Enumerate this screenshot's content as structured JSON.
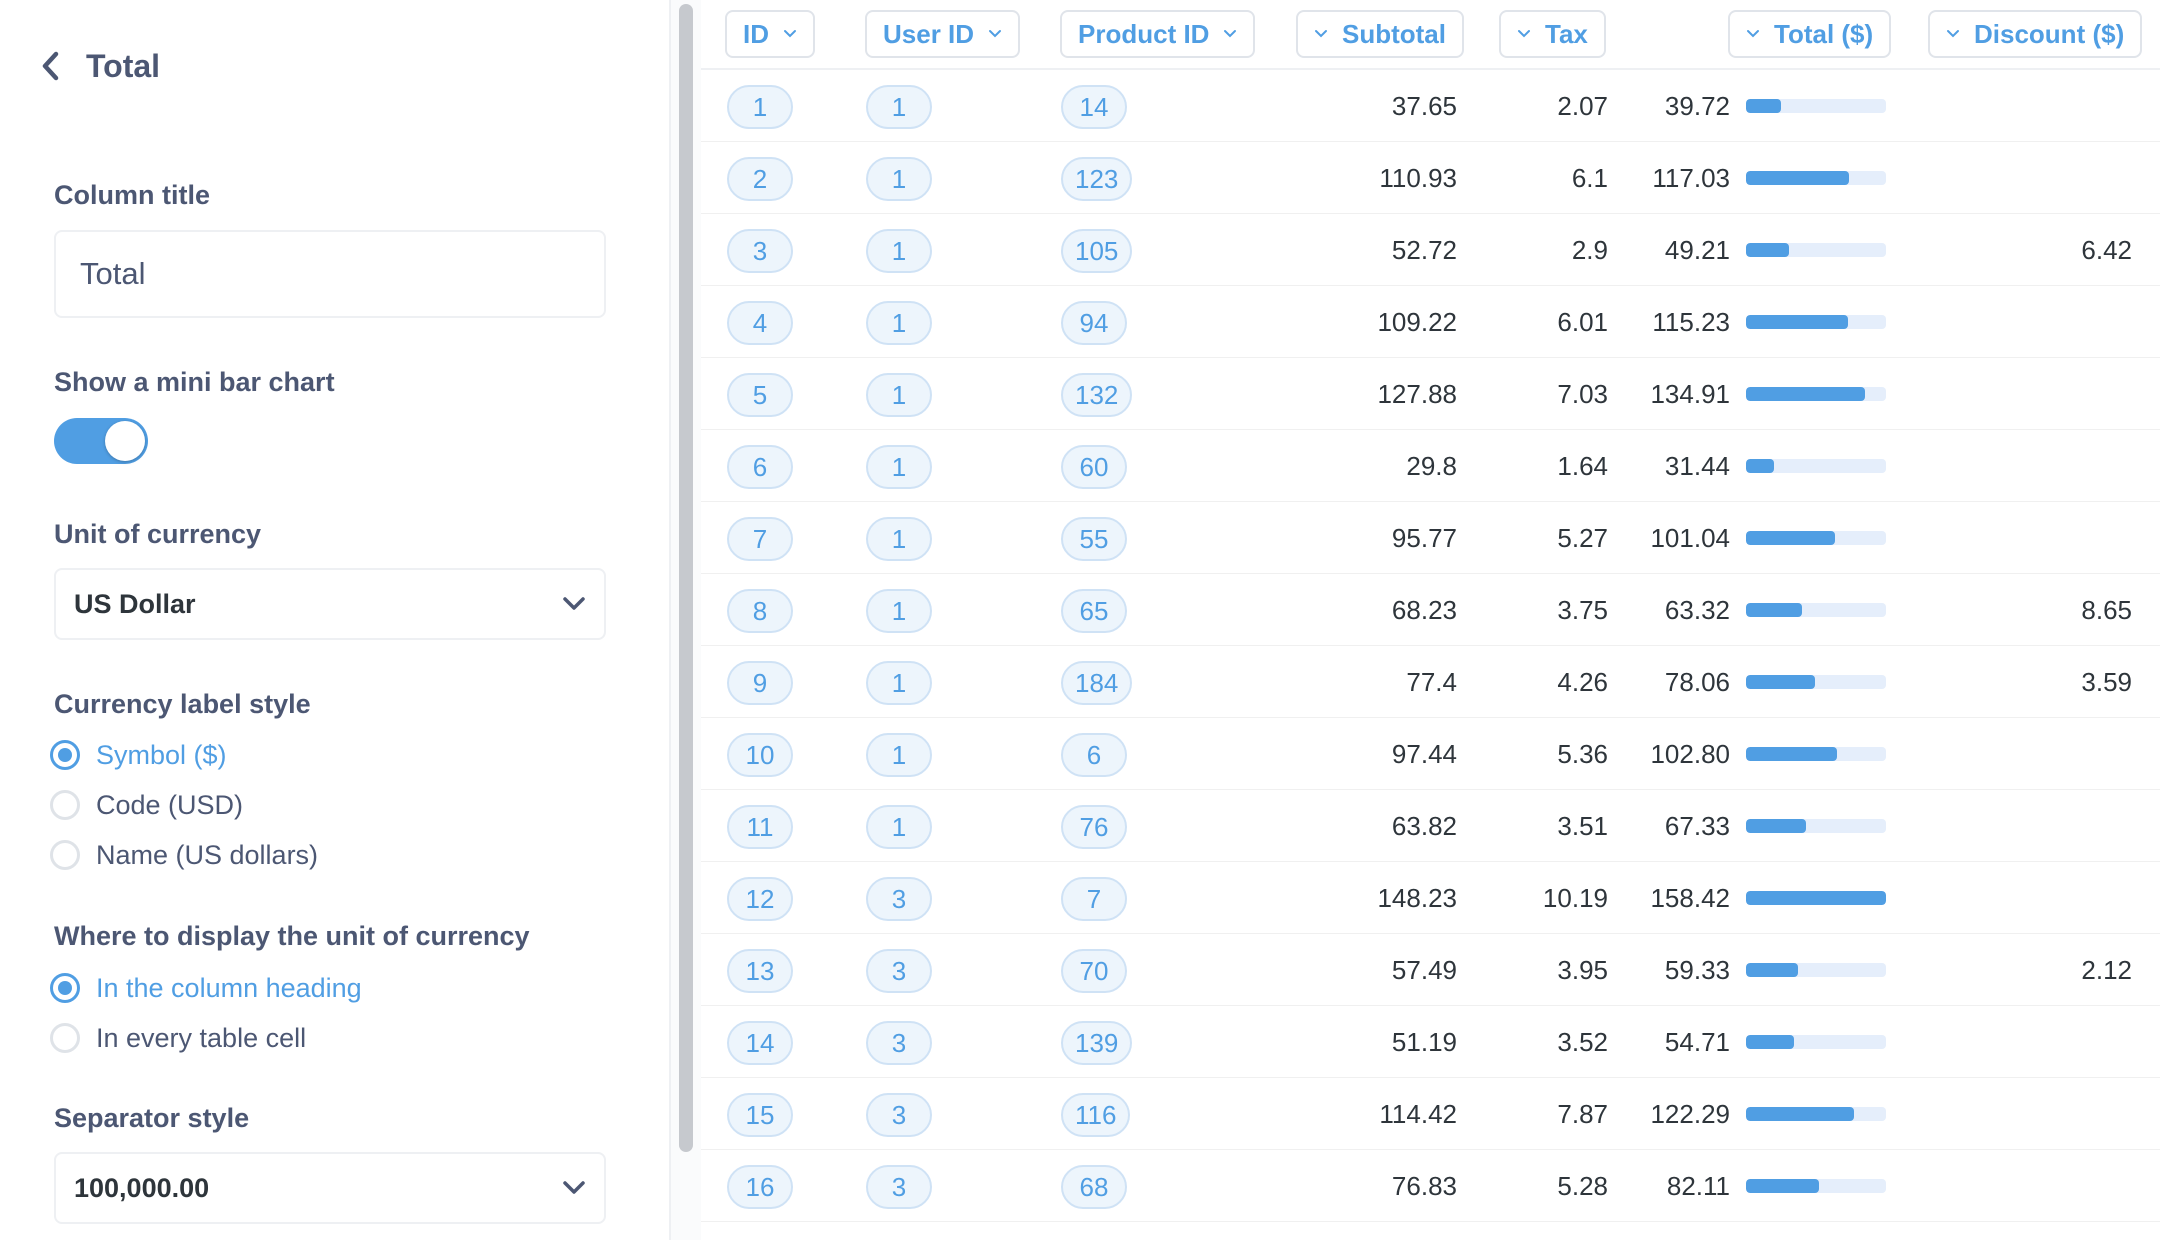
{
  "panel": {
    "title": "Total",
    "column_title": {
      "label": "Column title",
      "value": "Total"
    },
    "mini_bar_chart": {
      "label": "Show a mini bar chart",
      "enabled": true
    },
    "currency_unit": {
      "label": "Unit of currency",
      "value": "US Dollar"
    },
    "currency_label_style": {
      "label": "Currency label style",
      "options": [
        {
          "label": "Symbol ($)",
          "selected": true
        },
        {
          "label": "Code (USD)",
          "selected": false
        },
        {
          "label": "Name (US dollars)",
          "selected": false
        }
      ]
    },
    "currency_display": {
      "label": "Where to display the unit of currency",
      "options": [
        {
          "label": "In the column heading",
          "selected": true
        },
        {
          "label": "In every table cell",
          "selected": false
        }
      ]
    },
    "separator_style": {
      "label": "Separator style",
      "value": "100,000.00"
    }
  },
  "table": {
    "columns": [
      "ID",
      "User ID",
      "Product ID",
      "Subtotal",
      "Tax",
      "Total ($)",
      "Discount ($)"
    ],
    "total_bar_max": 158.42,
    "rows": [
      {
        "id": "1",
        "user_id": "1",
        "product_id": "14",
        "subtotal": "37.65",
        "tax": "2.07",
        "total": "39.72",
        "discount": ""
      },
      {
        "id": "2",
        "user_id": "1",
        "product_id": "123",
        "subtotal": "110.93",
        "tax": "6.1",
        "total": "117.03",
        "discount": ""
      },
      {
        "id": "3",
        "user_id": "1",
        "product_id": "105",
        "subtotal": "52.72",
        "tax": "2.9",
        "total": "49.21",
        "discount": "6.42"
      },
      {
        "id": "4",
        "user_id": "1",
        "product_id": "94",
        "subtotal": "109.22",
        "tax": "6.01",
        "total": "115.23",
        "discount": ""
      },
      {
        "id": "5",
        "user_id": "1",
        "product_id": "132",
        "subtotal": "127.88",
        "tax": "7.03",
        "total": "134.91",
        "discount": ""
      },
      {
        "id": "6",
        "user_id": "1",
        "product_id": "60",
        "subtotal": "29.8",
        "tax": "1.64",
        "total": "31.44",
        "discount": ""
      },
      {
        "id": "7",
        "user_id": "1",
        "product_id": "55",
        "subtotal": "95.77",
        "tax": "5.27",
        "total": "101.04",
        "discount": ""
      },
      {
        "id": "8",
        "user_id": "1",
        "product_id": "65",
        "subtotal": "68.23",
        "tax": "3.75",
        "total": "63.32",
        "discount": "8.65"
      },
      {
        "id": "9",
        "user_id": "1",
        "product_id": "184",
        "subtotal": "77.4",
        "tax": "4.26",
        "total": "78.06",
        "discount": "3.59"
      },
      {
        "id": "10",
        "user_id": "1",
        "product_id": "6",
        "subtotal": "97.44",
        "tax": "5.36",
        "total": "102.80",
        "discount": ""
      },
      {
        "id": "11",
        "user_id": "1",
        "product_id": "76",
        "subtotal": "63.82",
        "tax": "3.51",
        "total": "67.33",
        "discount": ""
      },
      {
        "id": "12",
        "user_id": "3",
        "product_id": "7",
        "subtotal": "148.23",
        "tax": "10.19",
        "total": "158.42",
        "discount": ""
      },
      {
        "id": "13",
        "user_id": "3",
        "product_id": "70",
        "subtotal": "57.49",
        "tax": "3.95",
        "total": "59.33",
        "discount": "2.12"
      },
      {
        "id": "14",
        "user_id": "3",
        "product_id": "139",
        "subtotal": "51.19",
        "tax": "3.52",
        "total": "54.71",
        "discount": ""
      },
      {
        "id": "15",
        "user_id": "3",
        "product_id": "116",
        "subtotal": "114.42",
        "tax": "7.87",
        "total": "122.29",
        "discount": ""
      },
      {
        "id": "16",
        "user_id": "3",
        "product_id": "68",
        "subtotal": "76.83",
        "tax": "5.28",
        "total": "82.11",
        "discount": ""
      }
    ]
  },
  "colors": {
    "accent": "#509ee3",
    "text": "#4c5773",
    "cell_text": "#2e353b"
  }
}
